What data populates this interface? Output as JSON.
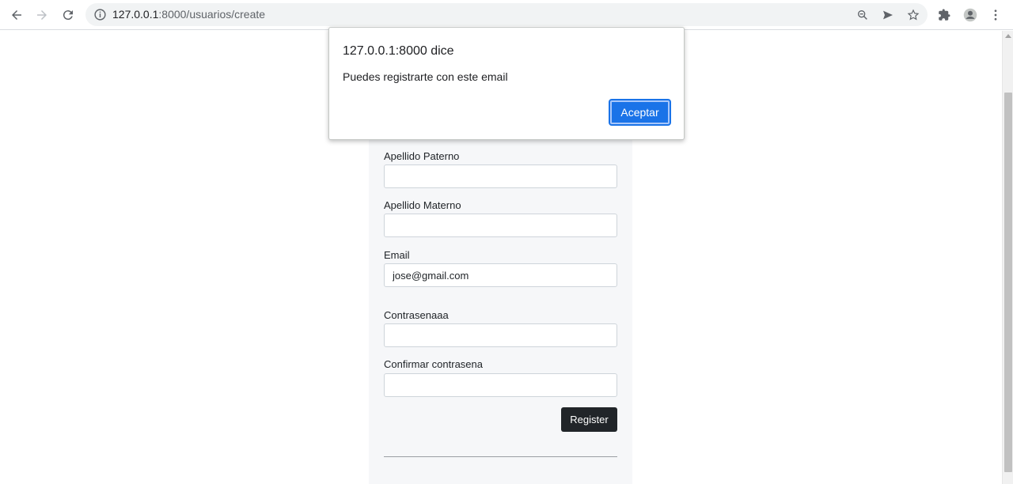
{
  "browser": {
    "url_host": "127.0.0.1",
    "url_rest": ":8000/usuarios/create",
    "icons": [
      "back-arrow-icon",
      "forward-arrow-icon",
      "reload-icon",
      "info-icon",
      "zoom-icon",
      "send-icon",
      "star-icon",
      "extensions-icon",
      "profile-icon",
      "menu-dots-icon"
    ]
  },
  "form": {
    "fields": [
      {
        "label": "Apellido Paterno",
        "value": ""
      },
      {
        "label": "Apellido Materno",
        "value": ""
      },
      {
        "label": "Email",
        "value": "jose@gmail.com"
      },
      {
        "label": "Contrasenaaa",
        "value": ""
      },
      {
        "label": "Confirmar contrasena",
        "value": ""
      }
    ],
    "submit_label": "Register"
  },
  "dialog": {
    "title": "127.0.0.1:8000 dice",
    "message": "Puedes registrarte con este email",
    "ok_label": "Aceptar"
  },
  "colors": {
    "accent": "#1a73e8",
    "button_dark": "#212529"
  }
}
